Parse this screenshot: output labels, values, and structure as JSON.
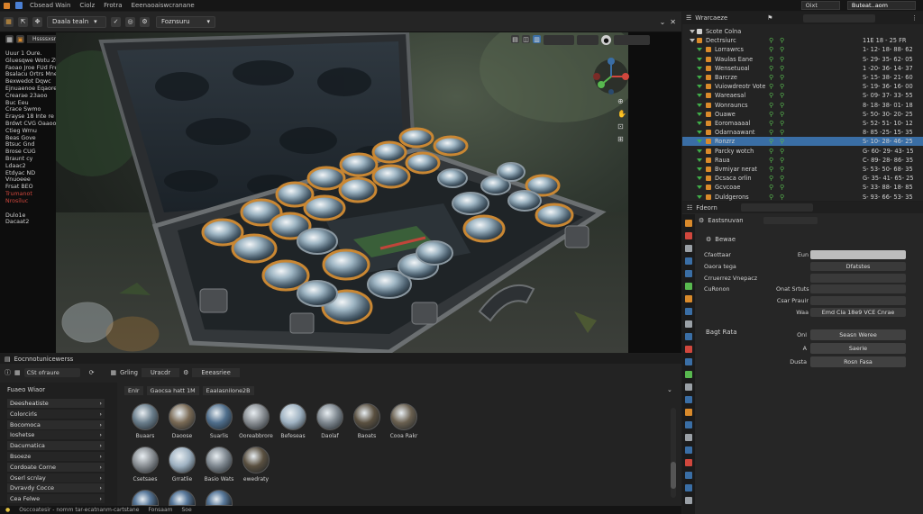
{
  "topbar": {
    "menus": [
      "Cbsead Wain",
      "Ciolz",
      "Frotra",
      "Eeenaoaiswcranane"
    ],
    "right_field_1": "Oixt",
    "right_field_2": "Buteat..aom"
  },
  "viewport_header": {
    "mode_label": "Daala tealn",
    "shading_label": "Foznsuru"
  },
  "viewport": {
    "header_chip": "Hssssxsnneraan",
    "stats": [
      "Uuur 1 Oure.",
      "Gluesqwe Wotu ZUthrem",
      "Faoao Jroe FUd Freeran",
      "Bsalacu Ortrs Mnernean",
      "Bexwedot Dqwc",
      "Ejnuaenoe Eqaoreoa",
      "Crearae 23aoo",
      "Buc Eeu",
      "Crace Swmo",
      "Erayse 18 Inte re FU",
      "Brdwt CVG Oaaoodx",
      "Ctieg Wrnu",
      "Beas Gove",
      "Btsuc Gnd",
      "Brose CUG",
      "Braunt cy",
      "Ldaac2",
      "Etdyac ND",
      "Vnuoeee",
      "Frsat BEO"
    ],
    "stats_red": [
      "Trumanot",
      "Nrosiluc"
    ],
    "stats_bottom": [
      "Dulo1e",
      "Dacaat2"
    ]
  },
  "outliner": {
    "title": "Wrarcaeze",
    "rows": [
      {
        "name": "Scote Colna",
        "val": ""
      },
      {
        "name": "Dectrsiurc",
        "val": "11E 18 - 25 FR"
      },
      {
        "name": "Lorrawrcs",
        "val": "1- 12- 18- 88- 62"
      },
      {
        "name": "Waulas Eane",
        "val": "S- 29- 35- 62- 05"
      },
      {
        "name": "Wensetuoal",
        "val": "1 -20- 36- 14- 37"
      },
      {
        "name": "Barcrze",
        "val": "S- 15- 38- 21- 60"
      },
      {
        "name": "Vuiowdreotr Vote",
        "val": "S- 19- 36- 16- 00"
      },
      {
        "name": "Wareaesal",
        "val": "S- 09- 37- 33- 55"
      },
      {
        "name": "Wonrauncs",
        "val": "8- 18- 38- 01- 18"
      },
      {
        "name": "Ouawe",
        "val": "S- 50- 30- 20- 25"
      },
      {
        "name": "Eoromaaaal",
        "val": "S- 52- 51- 10- 12"
      },
      {
        "name": "Odarnaawant",
        "val": "8- 85 -25- 15- 35"
      },
      {
        "name": "Ronzrz",
        "val": "S- 10- 28- 46- 25"
      },
      {
        "name": "Parcky wotch",
        "val": "G- 60- 29- 43- 15"
      },
      {
        "name": "Raua",
        "val": "C- 89- 28- 86- 35"
      },
      {
        "name": "Bvmiyar nerat",
        "val": "S- 53- 50- 68- 35"
      },
      {
        "name": "Dcsaca orlin",
        "val": "G- 35- 41- 65- 25"
      },
      {
        "name": "Gcvcoae",
        "val": "S- 33- 88- 18- 85"
      },
      {
        "name": "Duldgerons",
        "val": "S- 93- 66- 53- 35"
      }
    ]
  },
  "properties": {
    "header": "Fdeorn",
    "tab": "Eastsnuvan",
    "section": "Bewae",
    "rows": [
      {
        "label": "Cfaottaar",
        "mid": "Eun",
        "field": ""
      },
      {
        "label": "Oaora tega",
        "mid": "",
        "field": "Dfatstes"
      },
      {
        "label": "Crruerrez Vnepacz",
        "mid": "",
        "field": ""
      },
      {
        "label": "CuRonon",
        "mid": "Onat Srtuts",
        "field": ""
      },
      {
        "label": "",
        "mid": "Csar Prauir",
        "field": ""
      },
      {
        "label": "",
        "mid": "Waa",
        "field": "Emd Cla 18e9 VCE Cnrae"
      }
    ],
    "bake_section": "Bagt Rata",
    "bake_rows": [
      {
        "mid": "Onl",
        "field": "Seasn Weree"
      },
      {
        "mid": "A",
        "field": "Saerie"
      },
      {
        "mid": "Dusta",
        "field": "Rosn Fasa"
      }
    ]
  },
  "bottom_panel": {
    "title": "Eocnnotunicewerss",
    "search_value": "CSt ofraure",
    "sidebar_title": "Fuaeo Wiaor",
    "sidebar_items": [
      "Deesheatiste",
      "Colorcirls",
      "Bocomoca",
      "Ioshetse",
      "Dacumatica",
      "Bsoeze",
      "Cordoate Corne",
      "Oserl scnlay",
      "Dvravdy Cocce",
      "Cea Felwe"
    ],
    "toolbar_items": [
      "Grling",
      "Uracdr",
      "Eeeasriee"
    ],
    "filter_chips": [
      "Enlr",
      "Gaocsa hatt 1M",
      "Eaalasnilone2B"
    ],
    "assets_row1": [
      "Buaars",
      "Daoose",
      "Suarlis",
      "Ooreabbrore",
      "Befeseas",
      "Daolaf",
      "Baoats",
      "Cooa Rakr"
    ],
    "assets_row2": [
      "Csetsaes",
      "Grratlie",
      "Basio Wats",
      "ewedraty"
    ],
    "status_items": [
      "Osccoatesir - nomm tar-ecatnanm-cartstane",
      "Fonsaam",
      "Soe"
    ]
  },
  "colors": {
    "accent_blue": "#3a6ea5",
    "object_orange": "#d98a2b",
    "green": "#58b84f",
    "red_text": "#d0473d",
    "bg": "#1d1d1d"
  }
}
